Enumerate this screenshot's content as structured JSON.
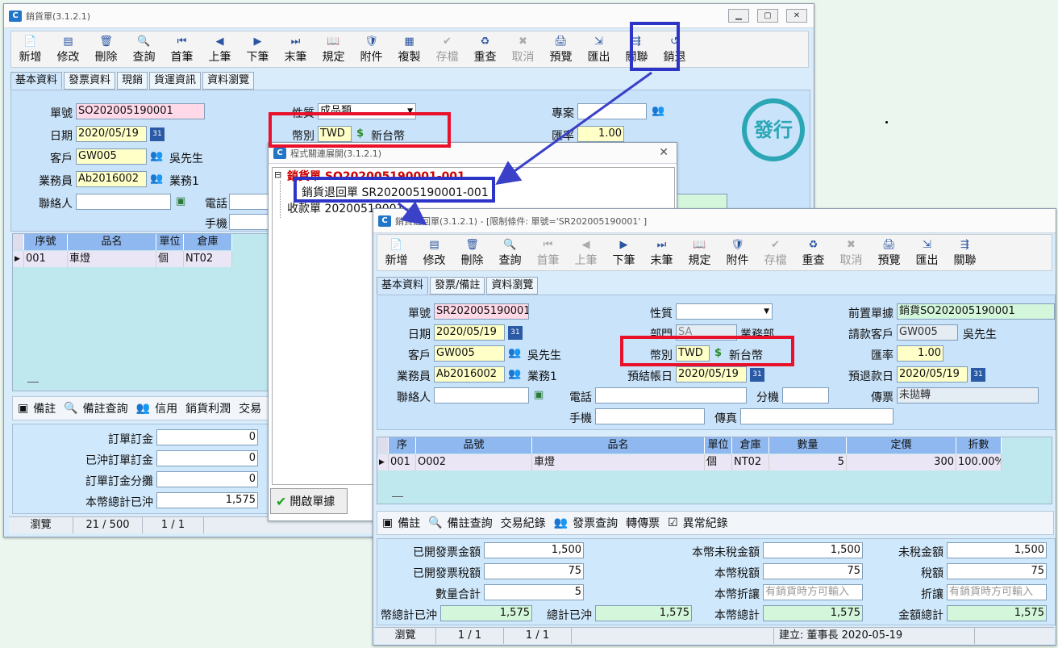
{
  "win1": {
    "title": "銷貨單(3.1.2.1)",
    "toolbar": [
      {
        "l": "新增",
        "i": "📄"
      },
      {
        "l": "修改",
        "i": "▤"
      },
      {
        "l": "刪除",
        "i": "🗑"
      },
      {
        "l": "查詢",
        "i": "🔍"
      },
      {
        "l": "首筆",
        "i": "⏮"
      },
      {
        "l": "上筆",
        "i": "◀"
      },
      {
        "l": "下筆",
        "i": "▶"
      },
      {
        "l": "末筆",
        "i": "⏭"
      },
      {
        "l": "規定",
        "i": "📖"
      },
      {
        "l": "附件",
        "i": "🛡"
      },
      {
        "l": "複製",
        "i": "▦"
      },
      {
        "l": "存檔",
        "i": "✔",
        "d": 1
      },
      {
        "l": "重查",
        "i": "♻"
      },
      {
        "l": "取消",
        "i": "✖",
        "d": 1
      },
      {
        "l": "預覽",
        "i": "🖨"
      },
      {
        "l": "匯出",
        "i": "⇲"
      },
      {
        "l": "關聯",
        "i": "⇶"
      },
      {
        "l": "銷退",
        "i": "↺"
      }
    ],
    "tabs": [
      "基本資料",
      "發票資料",
      "現銷",
      "貨運資訊",
      "資料瀏覽"
    ],
    "l_no": "單號",
    "no": "SO202005190001",
    "l_date": "日期",
    "date": "2020/05/19",
    "l_cust": "客戶",
    "cust": "GW005",
    "cust_name": "吳先生",
    "l_sales": "業務員",
    "sales": "Ab2016002",
    "sales_name": "業務1",
    "l_contact": "聯絡人",
    "l_phone": "電話",
    "l_mobile": "手機",
    "l_nature": "性質",
    "nature": "成品類",
    "l_cur": "幣別",
    "cur": "TWD",
    "cur_name": "新台幣",
    "l_proj": "專案",
    "l_rate": "匯率",
    "rate": "1.00",
    "stamp": "發行",
    "grid_head": [
      "序號",
      "品名",
      "單位",
      "倉庫"
    ],
    "grid_row": [
      "001",
      "車燈",
      "個",
      "NT02"
    ],
    "sub": [
      "備註",
      "備註查詢",
      "信用",
      "銷貨利潤",
      "交易"
    ],
    "l_t1": "訂單訂金",
    "t1": "0",
    "l_t2": "已沖訂單訂金",
    "t2": "0",
    "l_t3": "訂單訂金分攤",
    "t3": "0",
    "l_t4": "本幣總計已沖",
    "t4": "1,575",
    "status": [
      "瀏覽",
      "21 / 500",
      "1 / 1"
    ]
  },
  "dialog": {
    "title": "程式關連展開(3.1.2.1)",
    "root": "銷貨單 SO202005190001-001",
    "child1": "銷貨退回單 SR202005190001-001",
    "child2": "收款單 20200519001",
    "btn": "開啟單據"
  },
  "win2": {
    "title": "銷貨退回單(3.1.2.1) - [限制條件: 單號='SR202005190001' ]",
    "toolbar": [
      {
        "l": "新增",
        "i": "📄"
      },
      {
        "l": "修改",
        "i": "▤"
      },
      {
        "l": "刪除",
        "i": "🗑"
      },
      {
        "l": "查詢",
        "i": "🔍"
      },
      {
        "l": "首筆",
        "i": "⏮",
        "d": 1
      },
      {
        "l": "上筆",
        "i": "◀",
        "d": 1
      },
      {
        "l": "下筆",
        "i": "▶"
      },
      {
        "l": "末筆",
        "i": "⏭"
      },
      {
        "l": "規定",
        "i": "📖"
      },
      {
        "l": "附件",
        "i": "🛡"
      },
      {
        "l": "存檔",
        "i": "✔",
        "d": 1
      },
      {
        "l": "重查",
        "i": "♻"
      },
      {
        "l": "取消",
        "i": "✖",
        "d": 1
      },
      {
        "l": "預覽",
        "i": "🖨"
      },
      {
        "l": "匯出",
        "i": "⇲"
      },
      {
        "l": "關聯",
        "i": "⇶"
      }
    ],
    "tabs": [
      "基本資料",
      "發票/備註",
      "資料瀏覽"
    ],
    "l_no": "單號",
    "no": "SR202005190001",
    "l_date": "日期",
    "date": "2020/05/19",
    "l_cust": "客戶",
    "cust": "GW005",
    "cust_name": "吳先生",
    "l_sales": "業務員",
    "sales": "Ab2016002",
    "sales_name": "業務1",
    "l_contact": "聯絡人",
    "l_nature": "性質",
    "l_dept": "部門",
    "dept": "SA",
    "dept_name": "業務部",
    "l_cur": "幣別",
    "cur": "TWD",
    "cur_name": "新台幣",
    "l_settle": "預結帳日",
    "settle": "2020/05/19",
    "l_phone": "電話",
    "l_ext": "分機",
    "l_mobile": "手機",
    "l_fax": "傳真",
    "l_prev": "前置單據",
    "prev": "銷貨SO202005190001",
    "l_bcust": "請款客戶",
    "bcust": "GW005",
    "bcust_name": "吳先生",
    "l_rate": "匯率",
    "rate": "1.00",
    "l_refund": "預退款日",
    "refund": "2020/05/19",
    "l_transfer": "傳票",
    "transfer": "未拋轉",
    "grid_head": [
      "序",
      "品號",
      "品名",
      "單位",
      "倉庫",
      "數量",
      "定價",
      "折數"
    ],
    "grid_row": [
      "001",
      "O002",
      "車燈",
      "個",
      "NT02",
      "5",
      "300",
      "100.00%"
    ],
    "sub": [
      "備註",
      "備註查詢",
      "交易紀錄",
      "發票查詢",
      "轉傳票",
      "異常紀錄"
    ],
    "l_a1": "已開發票金額",
    "a1": "1,500",
    "l_a2": "已開發票稅額",
    "a2": "75",
    "l_a3": "數量合計",
    "a3": "5",
    "l_a4": "幣總計已沖",
    "a4": "1,575",
    "l_a5": "總計已沖",
    "a5": "1,575",
    "l_b1": "本幣未稅金額",
    "b1": "1,500",
    "l_b2": "本幣稅額",
    "b2": "75",
    "l_b3": "本幣折讓",
    "b3": "有銷貨時方可輸入",
    "l_b4": "本幣總計",
    "b4": "1,575",
    "l_c1": "未稅金額",
    "c1": "1,500",
    "l_c2": "稅額",
    "c2": "75",
    "l_c3": "折讓",
    "c3": "有銷貨時方可輸入",
    "l_c4": "金額總計",
    "c4": "1,575",
    "status": [
      "瀏覽",
      "1 / 1",
      "1 / 1",
      "建立: 董事長 2020-05-19"
    ]
  },
  "colors": {
    "red": "#e8102a",
    "blue": "#2d35c8"
  }
}
